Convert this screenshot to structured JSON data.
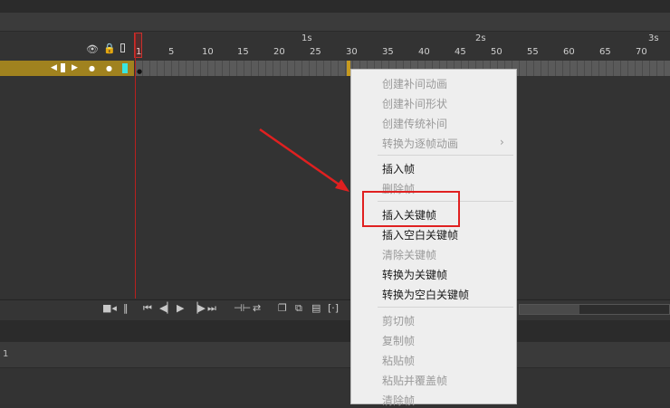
{
  "colors": {
    "accent_highlight": "#99c9f5",
    "layer_color": "#a0821f",
    "playhead": "#c9302c",
    "annotation": "#e02020"
  },
  "ruler": {
    "seconds": [
      "1s",
      "2s",
      "3s"
    ],
    "frames": [
      "1",
      "5",
      "10",
      "15",
      "20",
      "25",
      "30",
      "35",
      "40",
      "45",
      "50",
      "55",
      "60",
      "65",
      "70"
    ]
  },
  "panel2": {
    "row_number": "1"
  },
  "context_menu": {
    "items": [
      {
        "label": "创建补间动画",
        "enabled": false
      },
      {
        "label": "创建补间形状",
        "enabled": false
      },
      {
        "label": "创建传统补间",
        "enabled": false
      },
      {
        "label": "转换为逐帧动画",
        "enabled": false,
        "submenu": true
      },
      {
        "label": "插入帧",
        "enabled": true
      },
      {
        "label": "删除帧",
        "enabled": false
      },
      {
        "label": "插入关键帧",
        "enabled": true,
        "highlighted": true
      },
      {
        "label": "插入空白关键帧",
        "enabled": true
      },
      {
        "label": "清除关键帧",
        "enabled": false
      },
      {
        "label": "转换为关键帧",
        "enabled": true
      },
      {
        "label": "转换为空白关键帧",
        "enabled": true
      },
      {
        "label": "剪切帧",
        "enabled": false
      },
      {
        "label": "复制帧",
        "enabled": false
      },
      {
        "label": "粘贴帧",
        "enabled": false
      },
      {
        "label": "粘贴并覆盖帧",
        "enabled": false
      },
      {
        "label": "清除帧",
        "enabled": false
      }
    ],
    "submenu_glyph": "›"
  },
  "icons": {
    "eye": "eye-icon",
    "lock": "lock-icon",
    "outline": "outline-icon",
    "camera": "camera-icon",
    "go_first": "go-first-frame-icon",
    "step_back": "step-back-icon",
    "play": "play-icon",
    "step_forward": "step-forward-icon",
    "go_last": "go-last-frame-icon"
  }
}
